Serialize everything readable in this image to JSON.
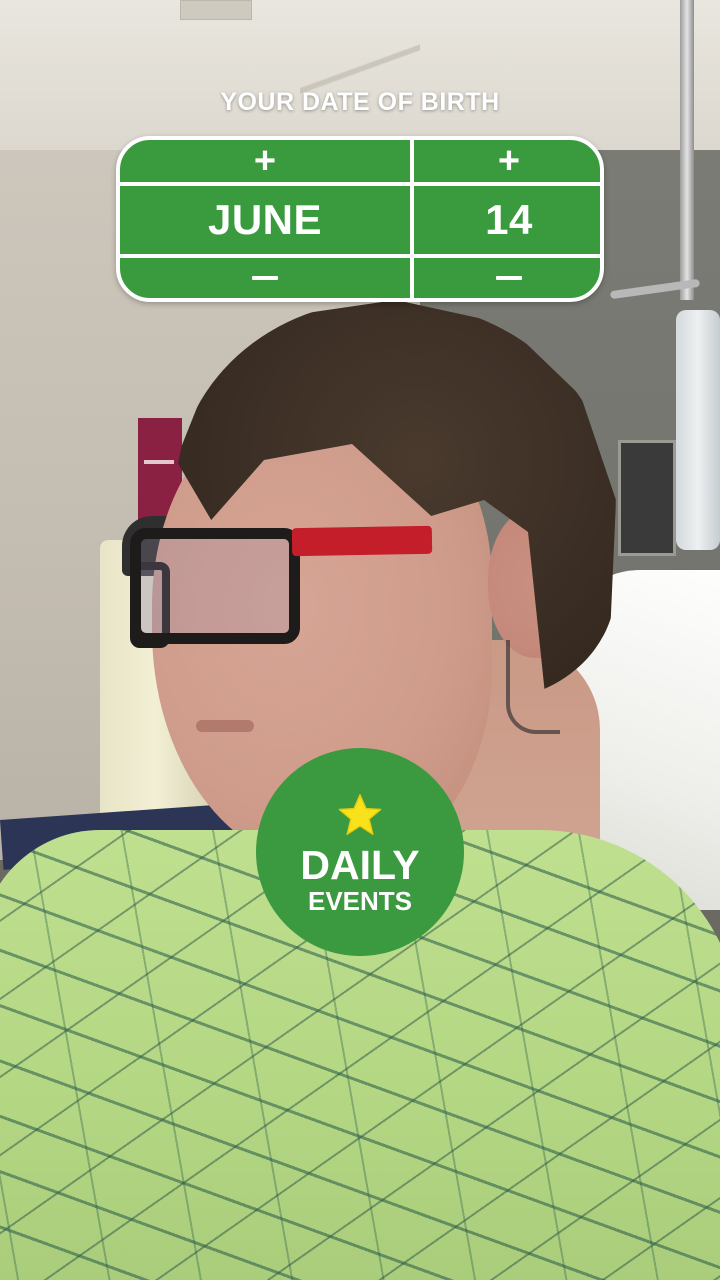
{
  "colors": {
    "accent_green": "#3a9a3e",
    "text_white": "#ffffff",
    "star_yellow": "#f7e21b"
  },
  "dob_picker": {
    "title": "YOUR DATE OF BIRTH",
    "month": {
      "increment_icon": "plus-icon",
      "value": "JUNE",
      "decrement_icon": "minus-icon"
    },
    "day": {
      "increment_icon": "plus-icon",
      "value": "14",
      "decrement_icon": "minus-icon"
    }
  },
  "daily_events": {
    "icon": "star-icon",
    "line1": "DAILY",
    "line2": "EVENTS"
  }
}
